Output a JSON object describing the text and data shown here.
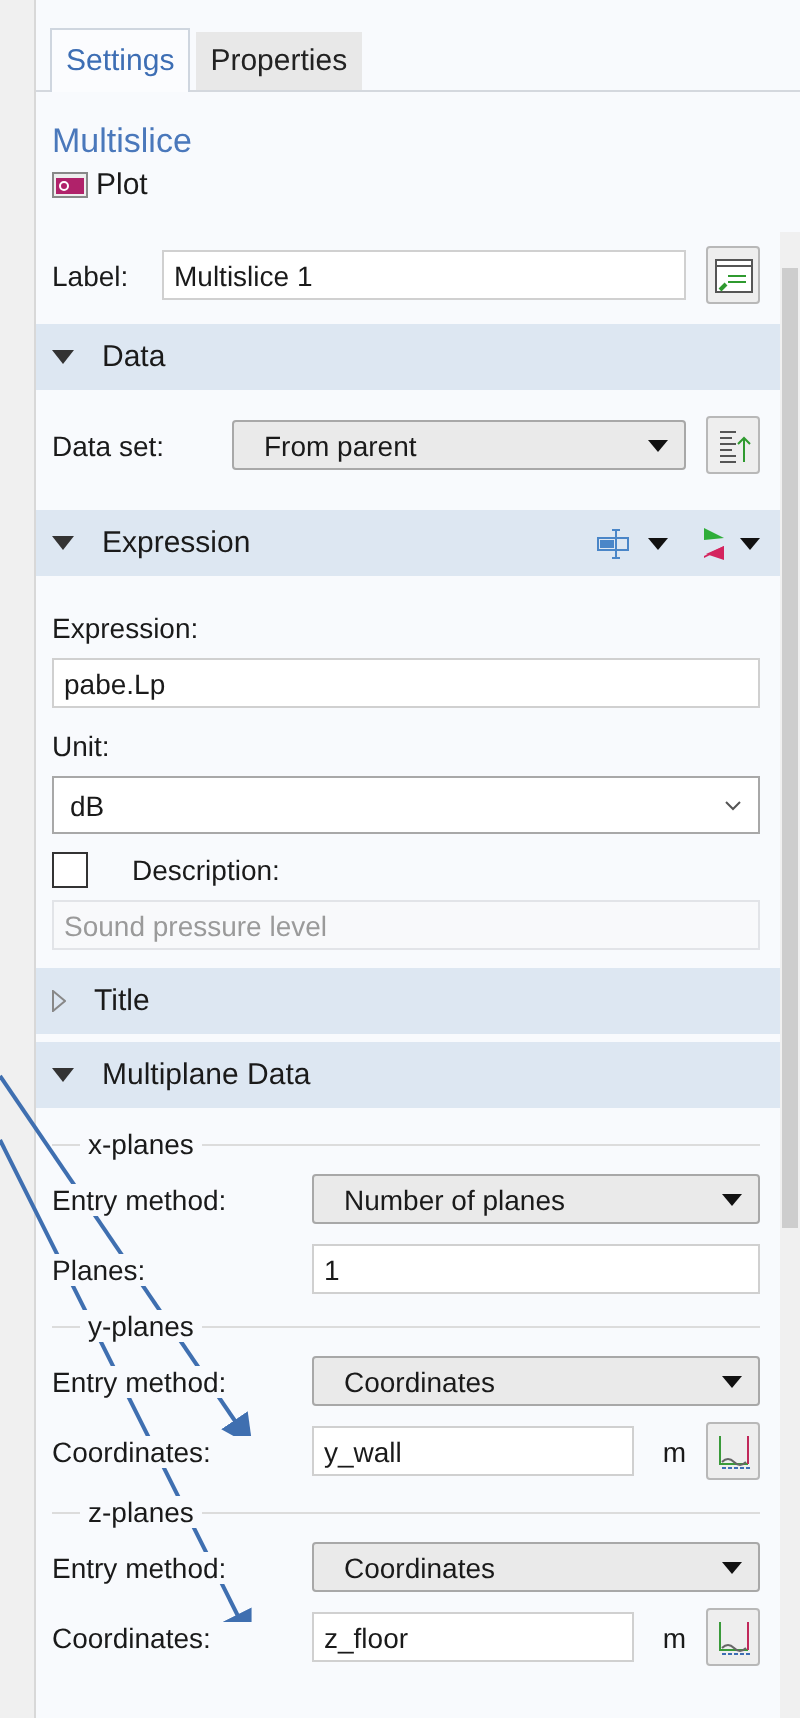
{
  "tabs": [
    {
      "label": "Settings",
      "selected": true
    },
    {
      "label": "Properties",
      "selected": false
    }
  ],
  "node": {
    "title": "Multislice",
    "type": "Plot"
  },
  "label_field": {
    "label": "Label:",
    "value": "Multislice 1"
  },
  "sections": [
    {
      "title": "Data",
      "expanded": true,
      "rows": [
        {
          "kind": "select-action",
          "label": "Data set:",
          "value": "From parent"
        }
      ]
    },
    {
      "title": "Expression",
      "expanded": true,
      "toolbar": true,
      "rows": [
        {
          "kind": "caption",
          "label": "Expression:"
        },
        {
          "kind": "input-wide",
          "value": "pabe.Lp"
        },
        {
          "kind": "caption",
          "label": "Unit:"
        },
        {
          "kind": "combo-wide",
          "value": "dB"
        },
        {
          "kind": "checkbox",
          "label": "Description:",
          "checked": false
        },
        {
          "kind": "readonly",
          "value": "Sound pressure level",
          "disabled": true
        }
      ]
    },
    {
      "title": "Title",
      "expanded": false
    },
    {
      "title": "Multiplane Data",
      "expanded": true,
      "rows": [
        {
          "kind": "group",
          "label": "x-planes"
        },
        {
          "kind": "select",
          "label": "Entry method:",
          "value": "Number of planes"
        },
        {
          "kind": "input",
          "label": "Planes:",
          "value": "1"
        },
        {
          "kind": "group",
          "label": "y-planes"
        },
        {
          "kind": "select",
          "label": "Entry method:",
          "value": "Coordinates"
        },
        {
          "kind": "input-unit",
          "label": "Coordinates:",
          "value": "y_wall",
          "unit": "m"
        },
        {
          "kind": "group",
          "label": "z-planes"
        },
        {
          "kind": "select",
          "label": "Entry method:",
          "value": "Coordinates"
        },
        {
          "kind": "input-unit",
          "label": "Coordinates:",
          "value": "z_floor",
          "unit": "m"
        }
      ]
    }
  ]
}
